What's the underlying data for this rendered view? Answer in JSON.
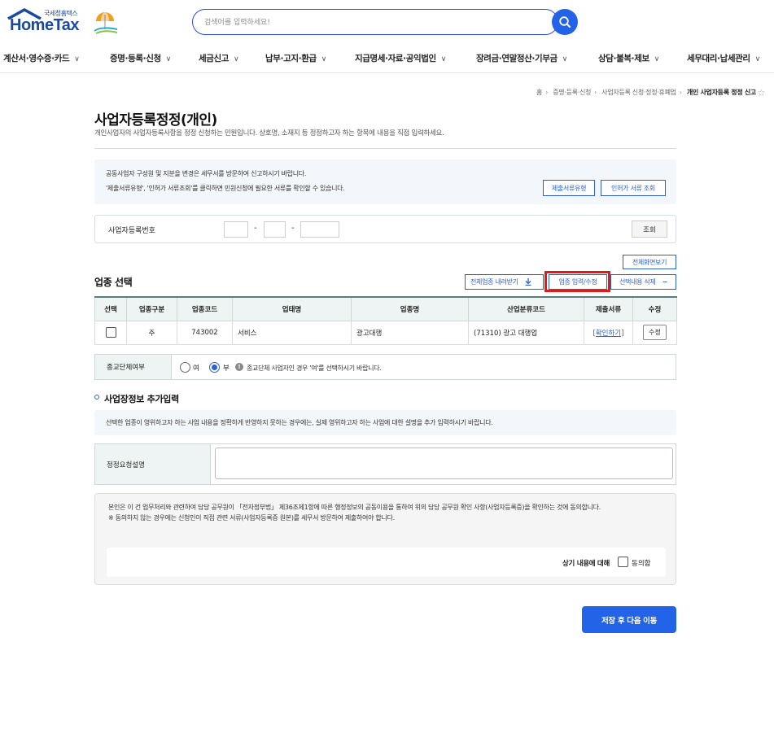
{
  "header": {
    "logo_small": "국세청홈택스",
    "logo_main": "HomeTax",
    "search_placeholder": "검색어를 입력하세요!"
  },
  "nav": [
    {
      "label": "계산서·영수증·카드"
    },
    {
      "label": "증명·등록·신청"
    },
    {
      "label": "세금신고"
    },
    {
      "label": "납부·고지·환급"
    },
    {
      "label": "지급명세·자료·공익법인"
    },
    {
      "label": "장려금·연말정산·기부금"
    },
    {
      "label": "상담·불복·제보"
    },
    {
      "label": "세무대리·납세관리"
    }
  ],
  "breadcrumb": [
    "홈",
    "증명·등록·신청",
    "사업자등록 신청·정정·휴폐업",
    "개인 사업자등록 정정 신고"
  ],
  "page": {
    "title": "사업자등록정정(개인)",
    "description": "개인사업자의 사업자등록사항을 정정 신청하는 민원입니다. 상호명, 소재지 등 정정하고자 하는 항목에 내용을 직접 입력하세요."
  },
  "notice": {
    "line1": "공동사업자 구성원 및 지분을 변경은 세무서를 방문하여 신고하시기 바랍니다.",
    "line2": "'제출서류유형', '인허가 서류조회'를 클릭하면 민원신청에 필요한 서류를 확인할 수 있습니다.",
    "btn_doc_type": "제출서류유형",
    "btn_permit": "인허가 서류 조회"
  },
  "reg": {
    "label": "사업자등록번호",
    "dash": "-",
    "btn_lookup": "조회"
  },
  "industry": {
    "title": "업종 선택",
    "btn_fullscreen": "전체화면보기",
    "btn_download": "전체업종 내려받기",
    "btn_edit": "업종 입력/수정",
    "btn_delete": "선택내용 삭제",
    "columns": [
      "선택",
      "업종구분",
      "업종코드",
      "업태명",
      "업종명",
      "산업분류코드",
      "제출서류",
      "수정"
    ],
    "rows": [
      {
        "type": "주",
        "code": "743002",
        "business": "서비스",
        "name": "광고대행",
        "ksic": "(71310) 광고 대행업",
        "docs": "[확인하기]",
        "edit": "수정"
      }
    ]
  },
  "religion": {
    "label": "종교단체여부",
    "opt_yes": "여",
    "opt_no": "부",
    "selected": "부",
    "note": "종교단체 사업자인 경우 '여'를 선택하시기 바랍니다."
  },
  "additional": {
    "title": "사업장정보 추가입력",
    "notice": "선택한 업종이 영위하고자 하는 사업 내용을 정확하게 반영하지 못하는 경우에는, 실제 영위하고자 하는 사업에 대한 설명을 추가 입력하시기 바랍니다.",
    "req_label": "정정요청설명",
    "req_value": ""
  },
  "consent": {
    "text1": "본인은 이 건 업무처리와 관련하여 담당 공무원이 「전자정부법」 제36조제1항에 따른 행정정보의 공동이용을 통하여 위의 담당 공무원 확인 사항(사업자등록증)을 확인하는 것에 동의합니다.",
    "text2": "※ 동의하지 않는 경우에는 신청인이 직접 관련 서류(사업자등록증 원본)를 세무서 방문하여 제출하여야 합니다.",
    "agree_label": "상기 내용에 대해",
    "agree_text": "동의함"
  },
  "footer": {
    "btn_next": "저장 후 다음 이동"
  },
  "colors": {
    "primary": "#2363e8",
    "highlight": "#e01919"
  }
}
